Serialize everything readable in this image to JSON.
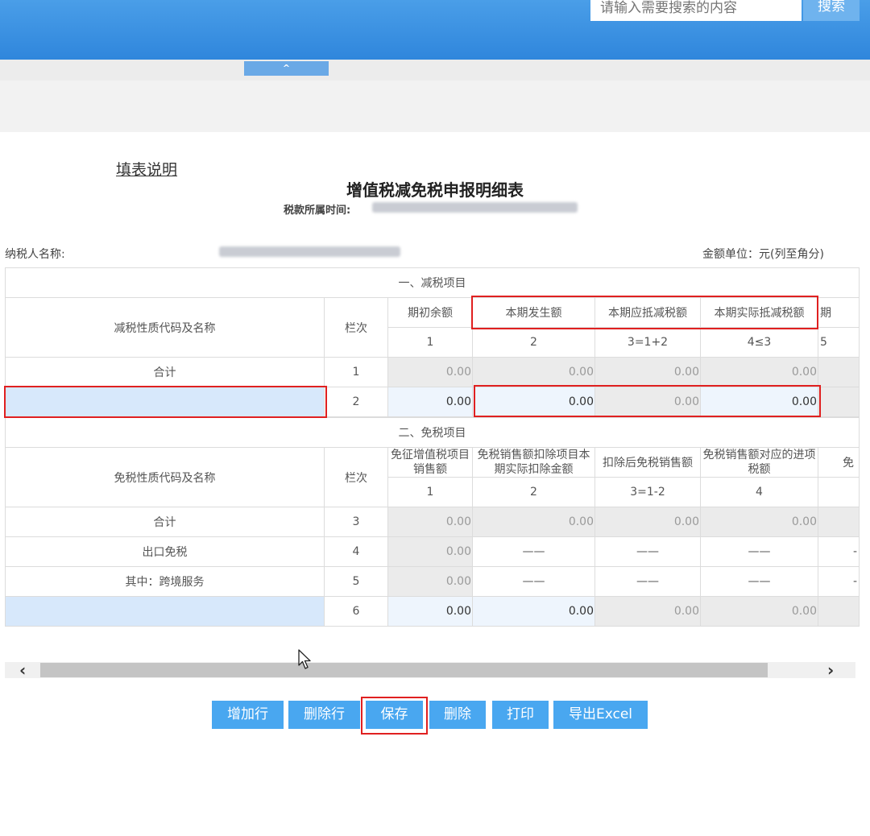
{
  "header": {
    "search_placeholder": "请输入需要搜索的内容",
    "search_button": "搜索",
    "collapse_glyph": "^"
  },
  "form": {
    "instructions_link": "填表说明",
    "title": "增值税减免税申报明细表",
    "period_label": "税款所属时间:",
    "taxpayer_label": "纳税人名称:",
    "unit_label": "金额单位：元(列至角分)"
  },
  "reduction": {
    "section_title": "一、减税项目",
    "name_header": "减税性质代码及名称",
    "col_header": "栏次",
    "columns": [
      "期初余额",
      "本期发生额",
      "本期应抵减税额",
      "本期实际抵减税额",
      "期"
    ],
    "column_numbers": [
      "1",
      "2",
      "3=1+2",
      "4≤3",
      "5"
    ],
    "rows": [
      {
        "name": "合计",
        "line": "1",
        "values": [
          "0.00",
          "0.00",
          "0.00",
          "0.00"
        ]
      },
      {
        "name": "",
        "line": "2",
        "values": [
          "0.00",
          "0.00",
          "0.00",
          "0.00"
        ]
      }
    ]
  },
  "exemption": {
    "section_title": "二、免税项目",
    "name_header": "免税性质代码及名称",
    "col_header": "栏次",
    "columns": [
      "免征增值税项目销售额",
      "免税销售额扣除项目本期实际扣除金额",
      "扣除后免税销售额",
      "免税销售额对应的进项税额",
      "免"
    ],
    "column_numbers": [
      "1",
      "2",
      "3=1-2",
      "4"
    ],
    "rows": [
      {
        "name": "合计",
        "line": "3",
        "values": [
          "0.00",
          "0.00",
          "0.00",
          "0.00"
        ],
        "tail": ""
      },
      {
        "name": "出口免税",
        "line": "4",
        "values": [
          "0.00",
          "——",
          "——",
          "——"
        ],
        "tail": "-"
      },
      {
        "name": "其中：跨境服务",
        "line": "5",
        "values": [
          "0.00",
          "——",
          "——",
          "——"
        ],
        "tail": "-"
      },
      {
        "name": "",
        "line": "6",
        "values": [
          "0.00",
          "0.00",
          "0.00",
          "0.00"
        ],
        "tail": ""
      }
    ]
  },
  "scrollbar": {
    "left_glyph": "‹",
    "right_glyph": "›"
  },
  "buttons": {
    "add_row": "增加行",
    "delete_row": "删除行",
    "save": "保存",
    "delete": "删除",
    "print": "打印",
    "export_excel": "导出Excel"
  },
  "colors": {
    "header_blue": "#2f86dc",
    "button_blue": "#49a7f0",
    "highlight_red": "#e02020"
  }
}
